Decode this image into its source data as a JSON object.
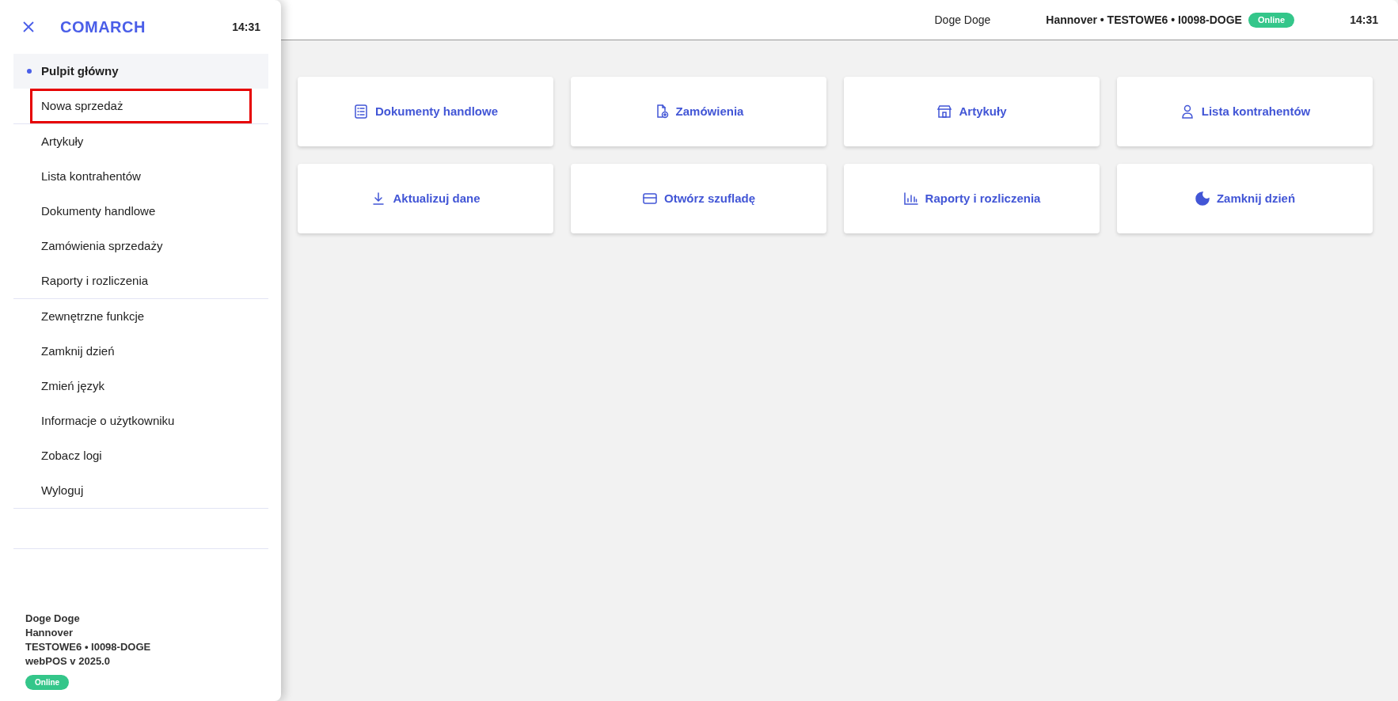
{
  "header": {
    "user": "Doge Doge",
    "location": "Hannover • TESTOWE6 • I0098-DOGE",
    "status": "Online",
    "time": "14:31"
  },
  "tiles": [
    {
      "label": "Dokumenty handlowe"
    },
    {
      "label": "Zamówienia"
    },
    {
      "label": "Artykuły"
    },
    {
      "label": "Lista kontrahentów"
    },
    {
      "label": "Aktualizuj dane"
    },
    {
      "label": "Otwórz szufladę"
    },
    {
      "label": "Raporty i rozliczenia"
    },
    {
      "label": "Zamknij dzień"
    }
  ],
  "sidebar": {
    "logo": "COMARCH",
    "time": "14:31",
    "sections": [
      {
        "items": [
          {
            "label": "Pulpit główny",
            "selected": true,
            "highlighted": false
          },
          {
            "label": "Nowa sprzedaż",
            "selected": false,
            "highlighted": true
          }
        ]
      },
      {
        "items": [
          {
            "label": "Artykuły",
            "selected": false,
            "highlighted": false
          },
          {
            "label": "Lista kontrahentów",
            "selected": false,
            "highlighted": false
          },
          {
            "label": "Dokumenty handlowe",
            "selected": false,
            "highlighted": false
          },
          {
            "label": "Zamówienia sprzedaży",
            "selected": false,
            "highlighted": false
          },
          {
            "label": "Raporty i rozliczenia",
            "selected": false,
            "highlighted": false
          }
        ]
      },
      {
        "items": [
          {
            "label": "Zewnętrzne funkcje",
            "selected": false,
            "highlighted": false
          },
          {
            "label": "Zamknij dzień",
            "selected": false,
            "highlighted": false
          },
          {
            "label": "Zmień język",
            "selected": false,
            "highlighted": false
          },
          {
            "label": "Informacje o użytkowniku",
            "selected": false,
            "highlighted": false
          },
          {
            "label": "Zobacz logi",
            "selected": false,
            "highlighted": false
          },
          {
            "label": "Wyloguj",
            "selected": false,
            "highlighted": false
          }
        ]
      }
    ],
    "footer": {
      "lines": [
        "Doge Doge",
        "Hannover",
        "TESTOWE6 • I0098-DOGE",
        "webPOS v 2025.0"
      ],
      "status": "Online"
    }
  }
}
